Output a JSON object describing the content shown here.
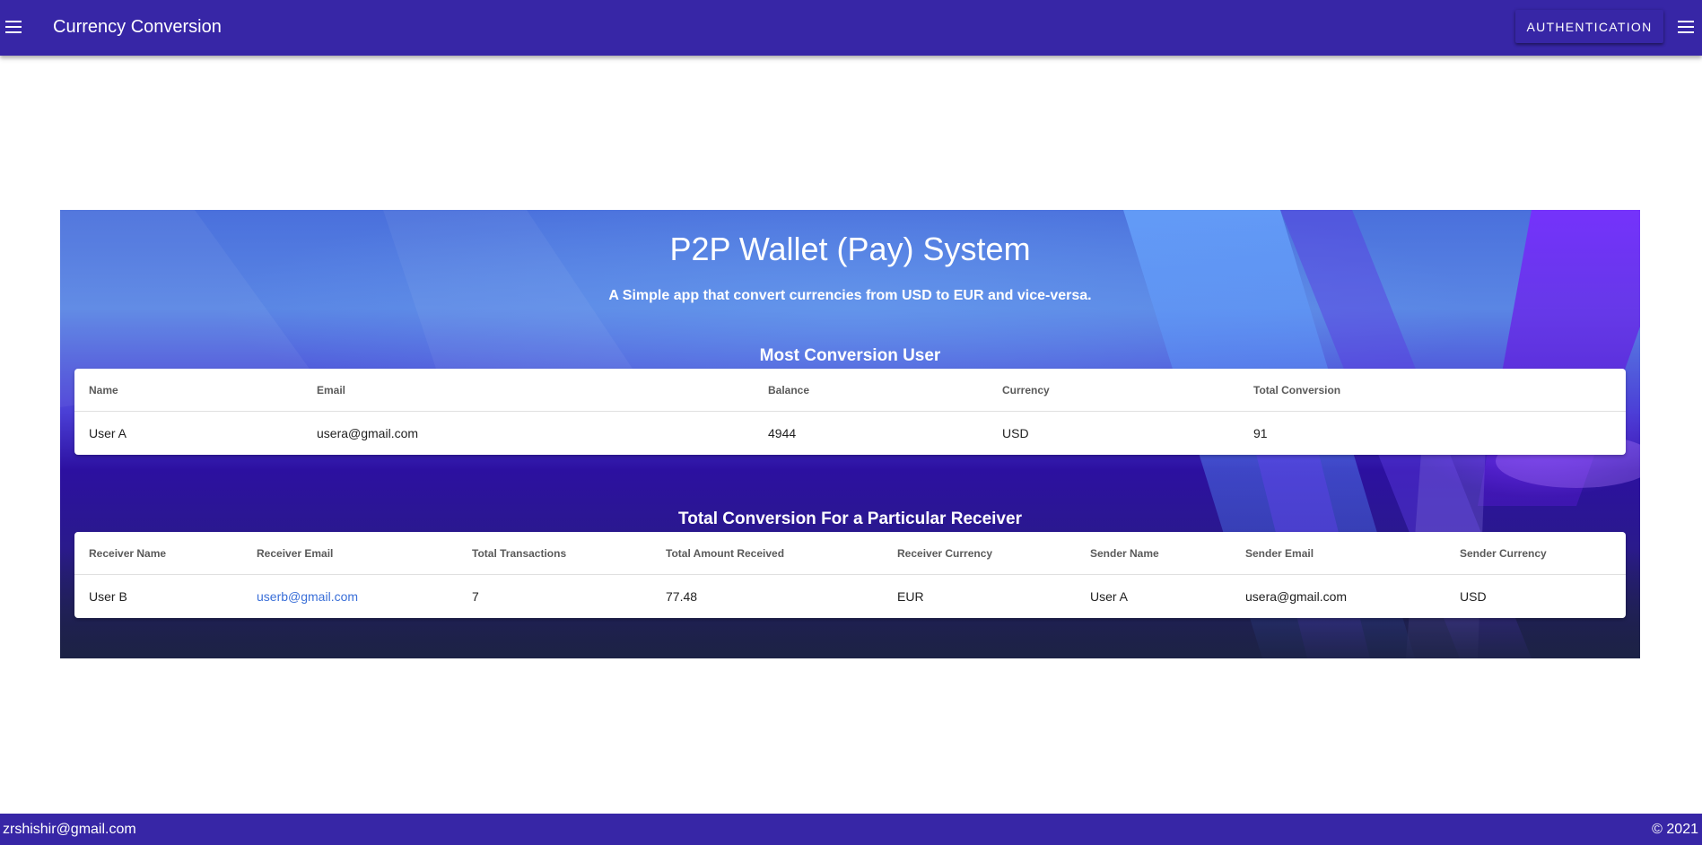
{
  "header": {
    "title": "Currency Conversion",
    "auth_button": "Authentication",
    "left_icon": "menu-icon",
    "right_icon": "menu-icon"
  },
  "hero": {
    "title": "P2P Wallet (Pay) System",
    "subtitle": "A Simple app that convert currencies from USD to EUR and vice-versa."
  },
  "most_conversion": {
    "title": "Most Conversion User",
    "columns": [
      "Name",
      "Email",
      "Balance",
      "Currency",
      "Total Conversion"
    ],
    "rows": [
      [
        "User A",
        "usera@gmail.com",
        "4944",
        "USD",
        "91"
      ]
    ]
  },
  "receiver_conversion": {
    "title": "Total Conversion For a Particular Receiver",
    "columns": [
      "Receiver Name",
      "Receiver Email",
      "Total Transactions",
      "Total Amount Received",
      "Receiver Currency",
      "Sender Name",
      "Sender Email",
      "Sender Currency"
    ],
    "rows": [
      [
        "User B",
        "userb@gmail.com",
        "7",
        "77.48",
        "EUR",
        "User A",
        "usera@gmail.com",
        "USD"
      ]
    ]
  },
  "footer": {
    "email": "zrshishir@gmail.com",
    "copyright": "© 2021"
  },
  "colors": {
    "primary": "#3726a6",
    "link": "#3a6fd8"
  }
}
